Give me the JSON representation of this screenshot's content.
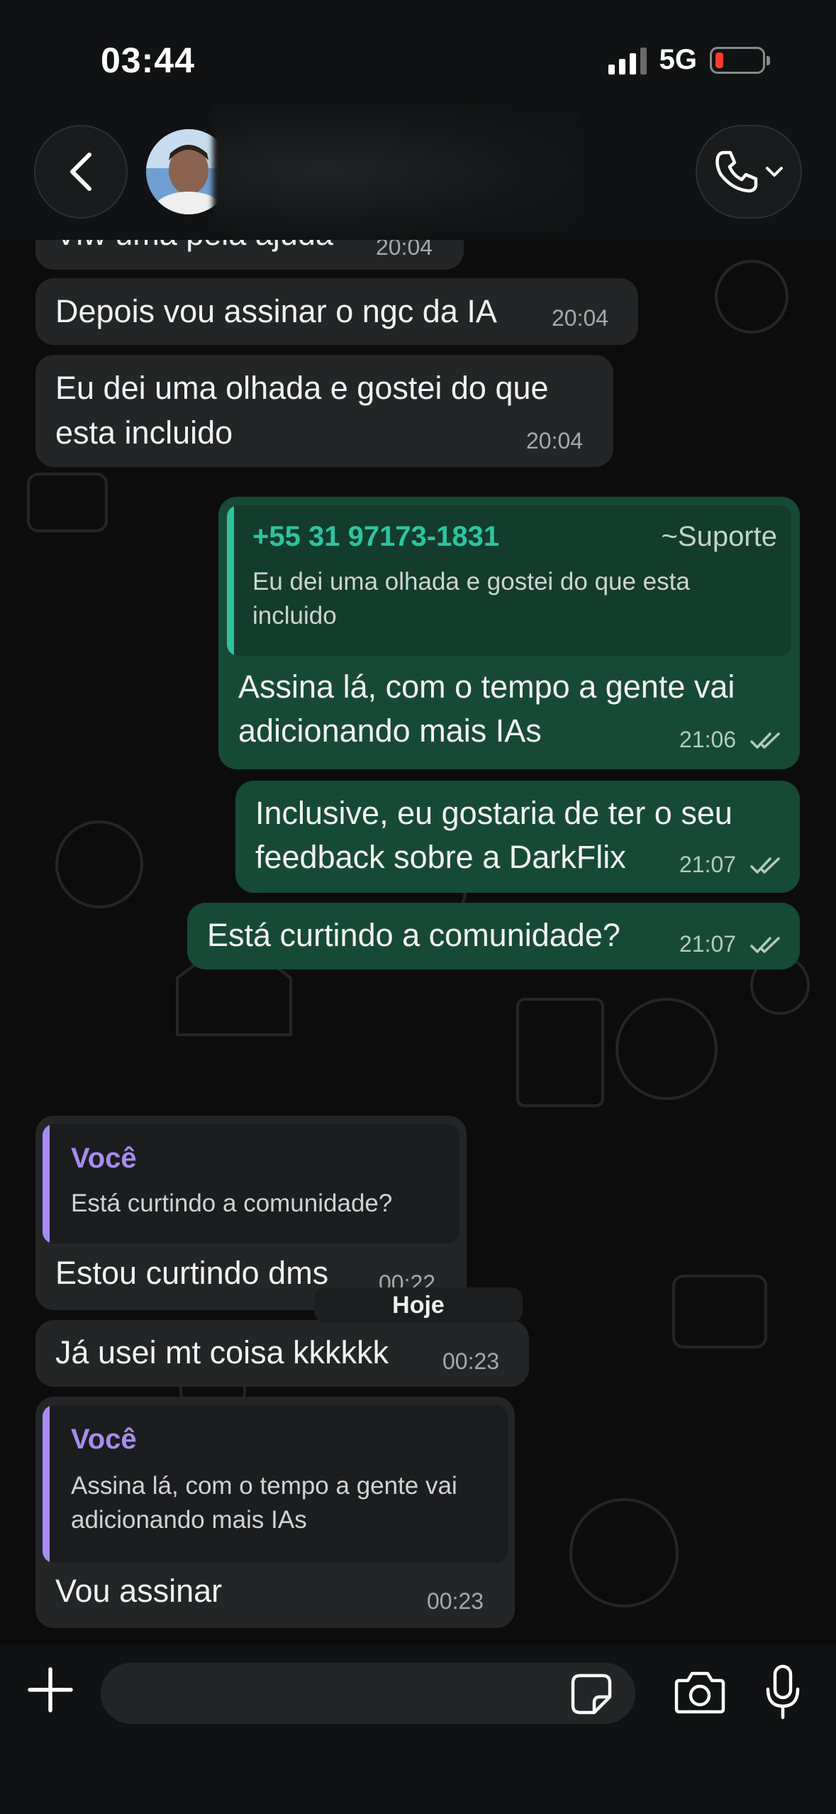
{
  "status_bar": {
    "time": "03:44",
    "network": "5G"
  },
  "header": {
    "contact_name_hidden": true
  },
  "chat": {
    "messages": [
      {
        "dir": "in",
        "text": "Viw uma pela ajuda",
        "time": "20:04"
      },
      {
        "dir": "in",
        "text": "Depois vou assinar o ngc da IA",
        "time": "20:04"
      },
      {
        "dir": "in",
        "lines": [
          "Eu dei uma olhada e gostei do que",
          "esta incluido"
        ],
        "time": "20:04"
      },
      {
        "dir": "out",
        "quote": {
          "name": "+55 31 97173-1831",
          "tag": "~Suporte",
          "lines": [
            "Eu dei uma olhada e gostei do que esta",
            "incluido"
          ]
        },
        "lines": [
          "Assina lá, com o tempo a gente vai",
          "adicionando mais IAs"
        ],
        "time": "21:06"
      },
      {
        "dir": "out",
        "lines": [
          "Inclusive, eu gostaria de ter o seu",
          "feedback sobre a DarkFlix"
        ],
        "time": "21:07"
      },
      {
        "dir": "out",
        "text": "Está curtindo a comunidade?",
        "time": "21:07"
      },
      {
        "dir": "in",
        "quote": {
          "name": "Você",
          "lines": [
            "Está curtindo a comunidade?"
          ]
        },
        "text": "Estou curtindo dms",
        "time": "00:22"
      },
      {
        "dir": "in",
        "text": "Já usei mt coisa kkkkkk",
        "time": "00:23"
      },
      {
        "dir": "in",
        "quote": {
          "name": "Você",
          "lines": [
            "Assina lá, com o tempo a gente vai",
            "adicionando mais IAs"
          ]
        },
        "text": "Vou assinar",
        "time": "00:23"
      }
    ],
    "date_divider": "Hoje"
  },
  "colors": {
    "incoming": "#242526",
    "outgoing": "#174a36",
    "quote_green": "#2ec4a0",
    "quote_purple": "#a68cf0",
    "background": "#0c0c0c"
  },
  "icons": [
    "back-chevron-icon",
    "phone-icon",
    "chevron-down-icon",
    "plus-icon",
    "sticker-icon",
    "camera-icon",
    "microphone-icon",
    "double-check-icon",
    "signal-icon",
    "battery-icon"
  ]
}
